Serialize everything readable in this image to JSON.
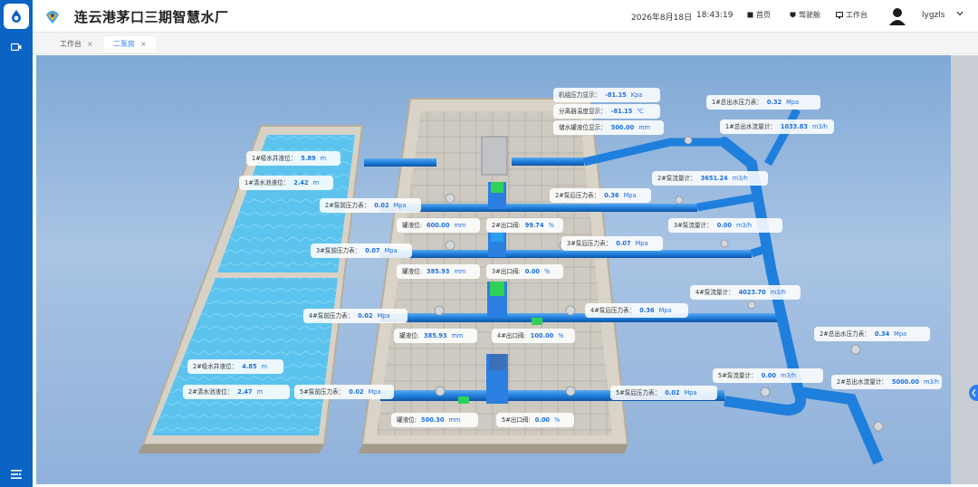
{
  "app": {
    "title": "连云港茅口三期智慧水厂"
  },
  "header": {
    "date": "2026年8月18日",
    "time": "18:43:19",
    "nav": [
      {
        "label": "首页",
        "icon": "home-icon"
      },
      {
        "label": "驾驶舱",
        "icon": "cockpit-icon"
      },
      {
        "label": "工作台",
        "icon": "monitor-icon"
      }
    ],
    "user": "lygzls"
  },
  "tabs": [
    {
      "label": "工作台",
      "close": "×",
      "active": false
    },
    {
      "label": "二泵房",
      "close": "×",
      "active": true
    }
  ],
  "labels": {
    "inlet_pressure": {
      "name": "机组压力显示：",
      "value": "-81.15",
      "unit": "Kpa"
    },
    "sep_temp": {
      "name": "分离器温度显示：",
      "value": "-81.15",
      "unit": "℃"
    },
    "tank_level": {
      "name": "储水罐液位显示：",
      "value": "500.00",
      "unit": "mm"
    },
    "tank1_level": {
      "name": "1#吸水井液位：",
      "value": "5.89",
      "unit": "m"
    },
    "clear1_level": {
      "name": "1#清水池液位：",
      "value": "2.42",
      "unit": "m"
    },
    "tank2_level": {
      "name": "2#吸水井液位：",
      "value": "4.85",
      "unit": "m"
    },
    "clear2_level": {
      "name": "2#清水池液位：",
      "value": "2.47",
      "unit": "m"
    },
    "pump2_in": {
      "name": "2#泵前压力表：",
      "value": "0.02",
      "unit": "Mpa"
    },
    "pump3_in": {
      "name": "3#泵前压力表：",
      "value": "0.07",
      "unit": "Mpa"
    },
    "pump4_in": {
      "name": "4#泵前压力表：",
      "value": "0.02",
      "unit": "Mpa"
    },
    "pump5_in": {
      "name": "5#泵前压力表：",
      "value": "0.02",
      "unit": "Mpa"
    },
    "pump2_level": {
      "name": "罐液位:",
      "value": "600.00",
      "unit": "mm"
    },
    "pump3_level": {
      "name": "罐液位:",
      "value": "385.93",
      "unit": "mm"
    },
    "pump4_level": {
      "name": "罐液位:",
      "value": "385.93",
      "unit": "mm"
    },
    "pump5_level": {
      "name": "罐液位:",
      "value": "500.30",
      "unit": "mm"
    },
    "valve2": {
      "name": "2#出口阀:",
      "value": "99.74",
      "unit": "%"
    },
    "valve3": {
      "name": "3#出口阀:",
      "value": "0.00",
      "unit": "%"
    },
    "valve4": {
      "name": "4#出口阀:",
      "value": "100.00",
      "unit": "%"
    },
    "valve5": {
      "name": "5#出口阀:",
      "value": "0.00",
      "unit": "%"
    },
    "pump2_out": {
      "name": "2#泵后压力表：",
      "value": "0.36",
      "unit": "Mpa"
    },
    "pump3_out": {
      "name": "3#泵后压力表：",
      "value": "0.07",
      "unit": "Mpa"
    },
    "pump4_out": {
      "name": "4#泵后压力表：",
      "value": "0.36",
      "unit": "Mpa"
    },
    "pump5_out": {
      "name": "5#泵后压力表：",
      "value": "0.02",
      "unit": "Mpa"
    },
    "flow2": {
      "name": "2#泵流量计：",
      "value": "3651.24",
      "unit": "m3/h"
    },
    "flow3": {
      "name": "3#泵流量计：",
      "value": "0.00",
      "unit": "m3/h"
    },
    "flow4": {
      "name": "4#泵流量计：",
      "value": "4023.70",
      "unit": "m3/h"
    },
    "flow5": {
      "name": "5#泵流量计：",
      "value": "0.00",
      "unit": "m3/h"
    },
    "out1_press": {
      "name": "1#总出水压力表：",
      "value": "0.32",
      "unit": "Mpa"
    },
    "out1_flow": {
      "name": "1#总出水流量计：",
      "value": "1033.83",
      "unit": "m3/h"
    },
    "out2_press": {
      "name": "2#总出水压力表：",
      "value": "0.34",
      "unit": "Mpa"
    },
    "out2_flow": {
      "name": "2#总出水流量计：",
      "value": "5000.00",
      "unit": "m3/h"
    }
  },
  "colors": {
    "brand": "#0b63c4",
    "pipe": "#1f7fdc",
    "water": "#4fb6e8",
    "accent": "#2d7ef7"
  }
}
